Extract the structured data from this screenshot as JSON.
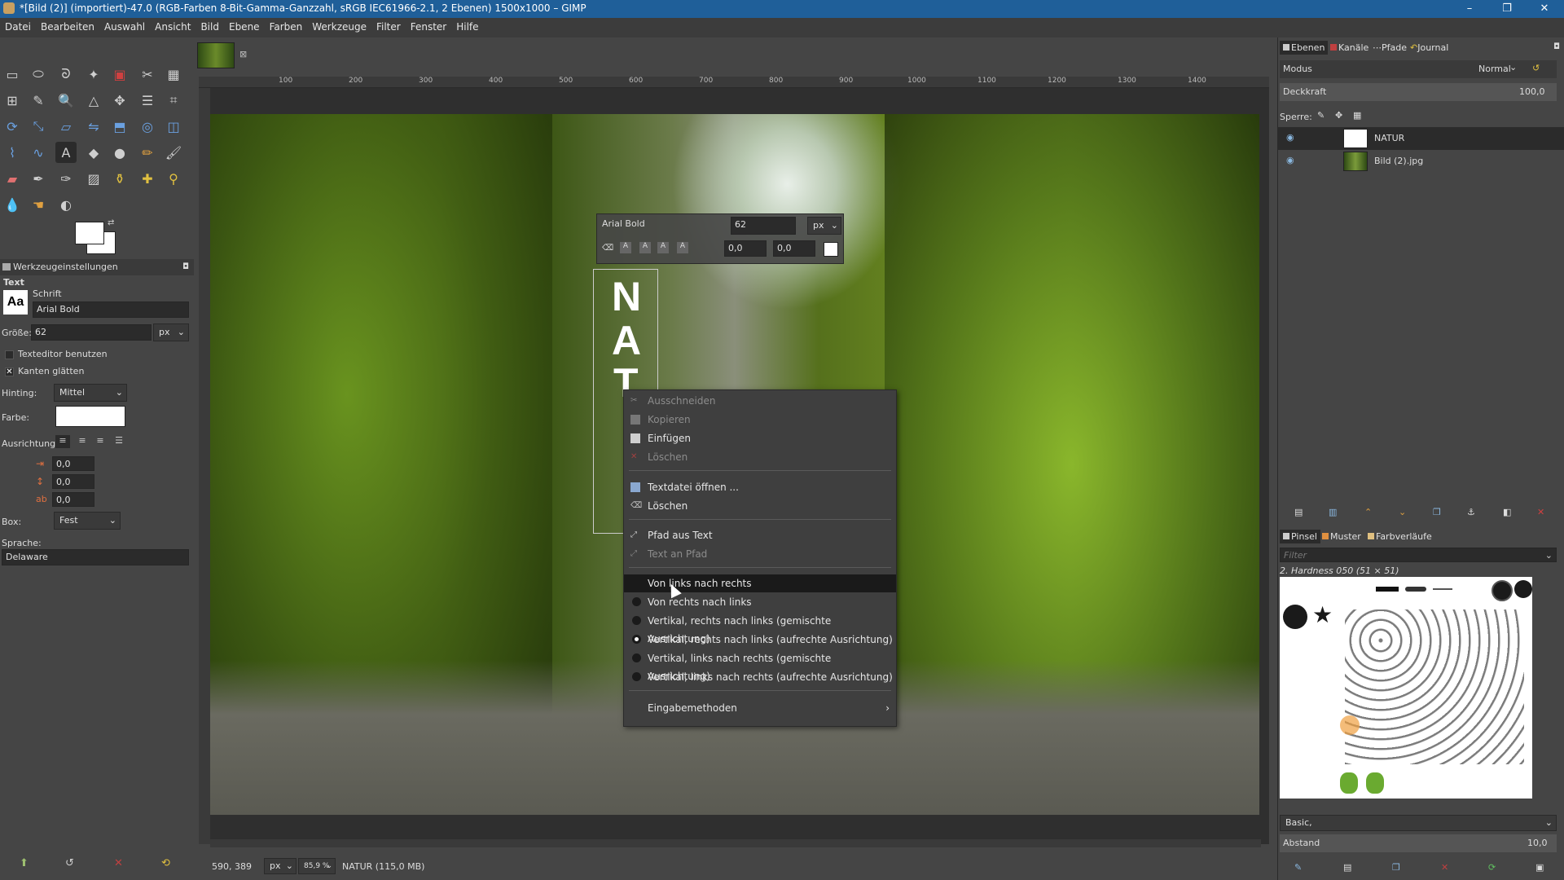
{
  "window": {
    "title": "*[Bild (2)] (importiert)-47.0 (RGB-Farben 8-Bit-Gamma-Ganzzahl, sRGB IEC61966-2.1, 2 Ebenen) 1500x1000 – GIMP",
    "controls": [
      "–",
      "❐",
      "✕"
    ]
  },
  "menubar": [
    "Datei",
    "Bearbeiten",
    "Auswahl",
    "Ansicht",
    "Bild",
    "Ebene",
    "Farben",
    "Werkzeuge",
    "Filter",
    "Fenster",
    "Hilfe"
  ],
  "ruler": {
    "h_ticks": [
      "100",
      "200",
      "300",
      "400",
      "500",
      "600",
      "700",
      "800",
      "900",
      "1000",
      "1100",
      "1200",
      "1300",
      "1400"
    ]
  },
  "tool_options": {
    "header": "Werkzeugeinstellungen",
    "tool_name": "Text",
    "font_label": "Schrift",
    "font_value": "Arial Bold",
    "font_icon_text": "Aa",
    "size_label": "Größe:",
    "size_value": "62",
    "size_unit": "px",
    "use_editor_label": "Texteditor benutzen",
    "antialias_label": "Kanten glätten",
    "hinting_label": "Hinting:",
    "hinting_value": "Mittel",
    "color_label": "Farbe:",
    "justify_label": "Ausrichtung:",
    "indent_value": "0,0",
    "line_spacing_value": "0,0",
    "letter_spacing_value": "0,0",
    "box_label": "Box:",
    "box_value": "Fest",
    "language_label": "Sprache:",
    "language_value": "Delaware"
  },
  "text_style_editor": {
    "font": "Arial Bold",
    "size": "62",
    "unit": "px",
    "baseline": "0,0",
    "kerning": "0,0",
    "swatch_color": "#ffffff"
  },
  "canvas_text_letters": [
    "N",
    "A",
    "T"
  ],
  "context_menu": {
    "items": [
      {
        "label": "Ausschneiden",
        "disabled": true,
        "icon": "cut-icon"
      },
      {
        "label": "Kopieren",
        "disabled": true,
        "icon": "copy-icon"
      },
      {
        "label": "Einfügen",
        "disabled": false,
        "icon": "paste-icon"
      },
      {
        "label": "Löschen",
        "disabled": true,
        "icon": "delete-icon"
      },
      {
        "label": "Textdatei öffnen ...",
        "disabled": false,
        "icon": "open-file-icon"
      },
      {
        "label": "Löschen",
        "disabled": false,
        "icon": "clear-icon"
      },
      {
        "label": "Pfad aus Text",
        "disabled": false,
        "icon": "path-icon"
      },
      {
        "label": "Text an Pfad",
        "disabled": true,
        "icon": "text-path-icon"
      },
      {
        "label": "Von links nach rechts",
        "highlighted": true
      },
      {
        "label": "Von rechts nach links"
      },
      {
        "label": "Vertikal, rechts nach links (gemischte Ausrichtung)"
      },
      {
        "label": "Vertikal, rechts nach links (aufrechte Ausrichtung)",
        "selected": true
      },
      {
        "label": "Vertikal, links nach rechts (gemischte Ausrichtung)"
      },
      {
        "label": "Vertikal, links nach rechts (aufrechte Ausrichtung)"
      },
      {
        "label": "Eingabemethoden",
        "submenu": true
      }
    ]
  },
  "layers_panel": {
    "tabs": [
      "Ebenen",
      "Kanäle",
      "Pfade",
      "Journal"
    ],
    "mode_label": "Modus",
    "mode_value": "Normal",
    "opacity_label": "Deckkraft",
    "opacity_value": "100,0",
    "lock_label": "Sperre:",
    "layers": [
      {
        "name": "NATUR",
        "selected": true
      },
      {
        "name": "Bild (2).jpg",
        "selected": false
      }
    ]
  },
  "brushes_panel": {
    "tabs": [
      "Pinsel",
      "Muster",
      "Farbverläufe"
    ],
    "filter_placeholder": "Filter",
    "brush_name": "2. Hardness 050 (51 × 51)",
    "preset": "Basic,",
    "spacing_label": "Abstand",
    "spacing_value": "10,0"
  },
  "statusbar": {
    "coords": "590, 389",
    "unit": "px",
    "zoom": "85,9 %",
    "layer_info": "NATUR (115,0 MB)"
  },
  "colors": {
    "titlebar": "#1f5f99",
    "panel_bg": "#454545",
    "menu_bg": "#3f3f3f",
    "foreground": "#ffffff",
    "background": "#ffffff"
  }
}
